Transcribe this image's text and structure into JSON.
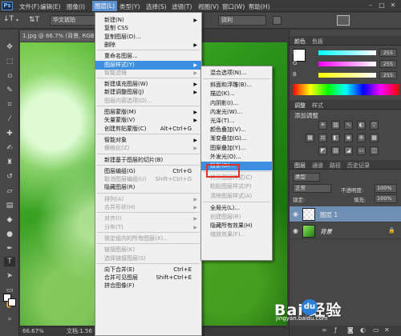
{
  "app": {
    "logo": "Ps"
  },
  "menubar": {
    "items": [
      "文件(F)",
      "编辑(E)",
      "图像(I)",
      "图层(L)",
      "类型(Y)",
      "选择(S)",
      "滤镜(T)",
      "视图(V)",
      "窗口(W)",
      "帮助(H)"
    ],
    "active_index": 3
  },
  "window_controls": {
    "minimize_icon": "minimize-icon",
    "maximize_icon": "maximize-icon",
    "close_icon": "close-icon"
  },
  "optionsbar": {
    "tool_icon": "text-tool-icon",
    "font_family": "华文琥珀",
    "antialias": "锐利"
  },
  "document": {
    "tab_title": "1.jpg @ 66.7% (背景, RGB/8)",
    "zoom": "66.67%",
    "doc_info": "文档:1.56"
  },
  "layer_menu": {
    "items": [
      {
        "label": "新建(N)",
        "submenu": true
      },
      {
        "label": "复制 CSS"
      },
      {
        "label": "复制图层(D)..."
      },
      {
        "label": "删除",
        "submenu": true
      },
      {
        "sep": true
      },
      {
        "label": "重命名图层..."
      },
      {
        "label": "图层样式(Y)",
        "submenu": true,
        "highlight": true
      },
      {
        "label": "智能滤镜",
        "disabled": true,
        "submenu": true
      },
      {
        "sep": true
      },
      {
        "label": "新建填充图层(W)",
        "submenu": true
      },
      {
        "label": "新建调整图层(J)",
        "submenu": true
      },
      {
        "label": "图层内容选项(O)...",
        "disabled": true
      },
      {
        "sep": true
      },
      {
        "label": "图层蒙版(M)",
        "submenu": true
      },
      {
        "label": "矢量蒙版(V)",
        "submenu": true
      },
      {
        "label": "创建剪贴蒙版(C)",
        "shortcut": "Alt+Ctrl+G"
      },
      {
        "sep": true
      },
      {
        "label": "智能对象",
        "submenu": true
      },
      {
        "label": "栅格化(Z)",
        "submenu": true,
        "disabled": true
      },
      {
        "sep": true
      },
      {
        "label": "新建基于图层的切片(B)"
      },
      {
        "sep": true
      },
      {
        "label": "图层编组(G)",
        "shortcut": "Ctrl+G"
      },
      {
        "label": "取消图层编组(U)",
        "shortcut": "Shift+Ctrl+G",
        "disabled": true
      },
      {
        "label": "隐藏图层(R)"
      },
      {
        "sep": true
      },
      {
        "label": "排列(A)",
        "submenu": true,
        "disabled": true
      },
      {
        "label": "合并形状(H)",
        "submenu": true,
        "disabled": true
      },
      {
        "sep": true
      },
      {
        "label": "对齐(I)",
        "submenu": true,
        "disabled": true
      },
      {
        "label": "分布(T)",
        "submenu": true,
        "disabled": true
      },
      {
        "sep": true
      },
      {
        "label": "锁定组内的所有图层(X)...",
        "disabled": true
      },
      {
        "sep": true
      },
      {
        "label": "链接图层(K)",
        "disabled": true
      },
      {
        "label": "选择链接图层(S)",
        "disabled": true
      },
      {
        "sep": true
      },
      {
        "label": "向下合并(E)",
        "shortcut": "Ctrl+E"
      },
      {
        "label": "合并可见图层",
        "shortcut": "Shift+Ctrl+E"
      },
      {
        "label": "拼合图像(F)"
      }
    ]
  },
  "style_submenu": {
    "items": [
      {
        "label": "混合选项(N)..."
      },
      {
        "sep": true
      },
      {
        "label": "斜面和浮雕(B)..."
      },
      {
        "label": "描边(K)..."
      },
      {
        "label": "内阴影(I)..."
      },
      {
        "label": "内发光(W)..."
      },
      {
        "label": "光泽(T)..."
      },
      {
        "label": "颜色叠加(V)..."
      },
      {
        "label": "渐变叠加(G)..."
      },
      {
        "label": "图案叠加(Y)..."
      },
      {
        "label": "外发光(O)..."
      },
      {
        "label": "投影(D)...",
        "highlight": true
      },
      {
        "sep": true
      },
      {
        "label": "拷贝图层样式(C)",
        "disabled": true
      },
      {
        "label": "粘贴图层样式(P)",
        "disabled": true
      },
      {
        "label": "清除图层样式(A)",
        "disabled": true
      },
      {
        "sep": true
      },
      {
        "label": "全局光(L)..."
      },
      {
        "label": "创建图层(R)",
        "disabled": true
      },
      {
        "label": "隐藏所有效果(H)"
      },
      {
        "label": "缩放效果(F)...",
        "disabled": true
      }
    ]
  },
  "color_panel": {
    "tabs": [
      "颜色",
      "色板"
    ],
    "sliders": [
      {
        "label": "R",
        "value": "255",
        "color": "#ff3030"
      },
      {
        "label": "G",
        "value": "255",
        "color": "#30d030"
      },
      {
        "label": "B",
        "value": "255",
        "color": "#3070ff"
      }
    ]
  },
  "adjust_panel": {
    "tabs": [
      "调整",
      "样式"
    ],
    "title": "添加调整"
  },
  "layers_panel": {
    "tabs": [
      "图层",
      "通道",
      "路径",
      "历史记录"
    ],
    "kind": "类型",
    "blend_mode": "正常",
    "opacity_label": "不透明度:",
    "opacity": "100%",
    "lock_label": "锁定:",
    "fill_label": "填充:",
    "fill": "100%",
    "layers": [
      {
        "name": "图层 1",
        "selected": true
      },
      {
        "name": "背景",
        "selected": false
      }
    ]
  },
  "watermark": {
    "text": "Bai  经验",
    "paw": "du",
    "sub": "jingyan.baidu.com"
  }
}
